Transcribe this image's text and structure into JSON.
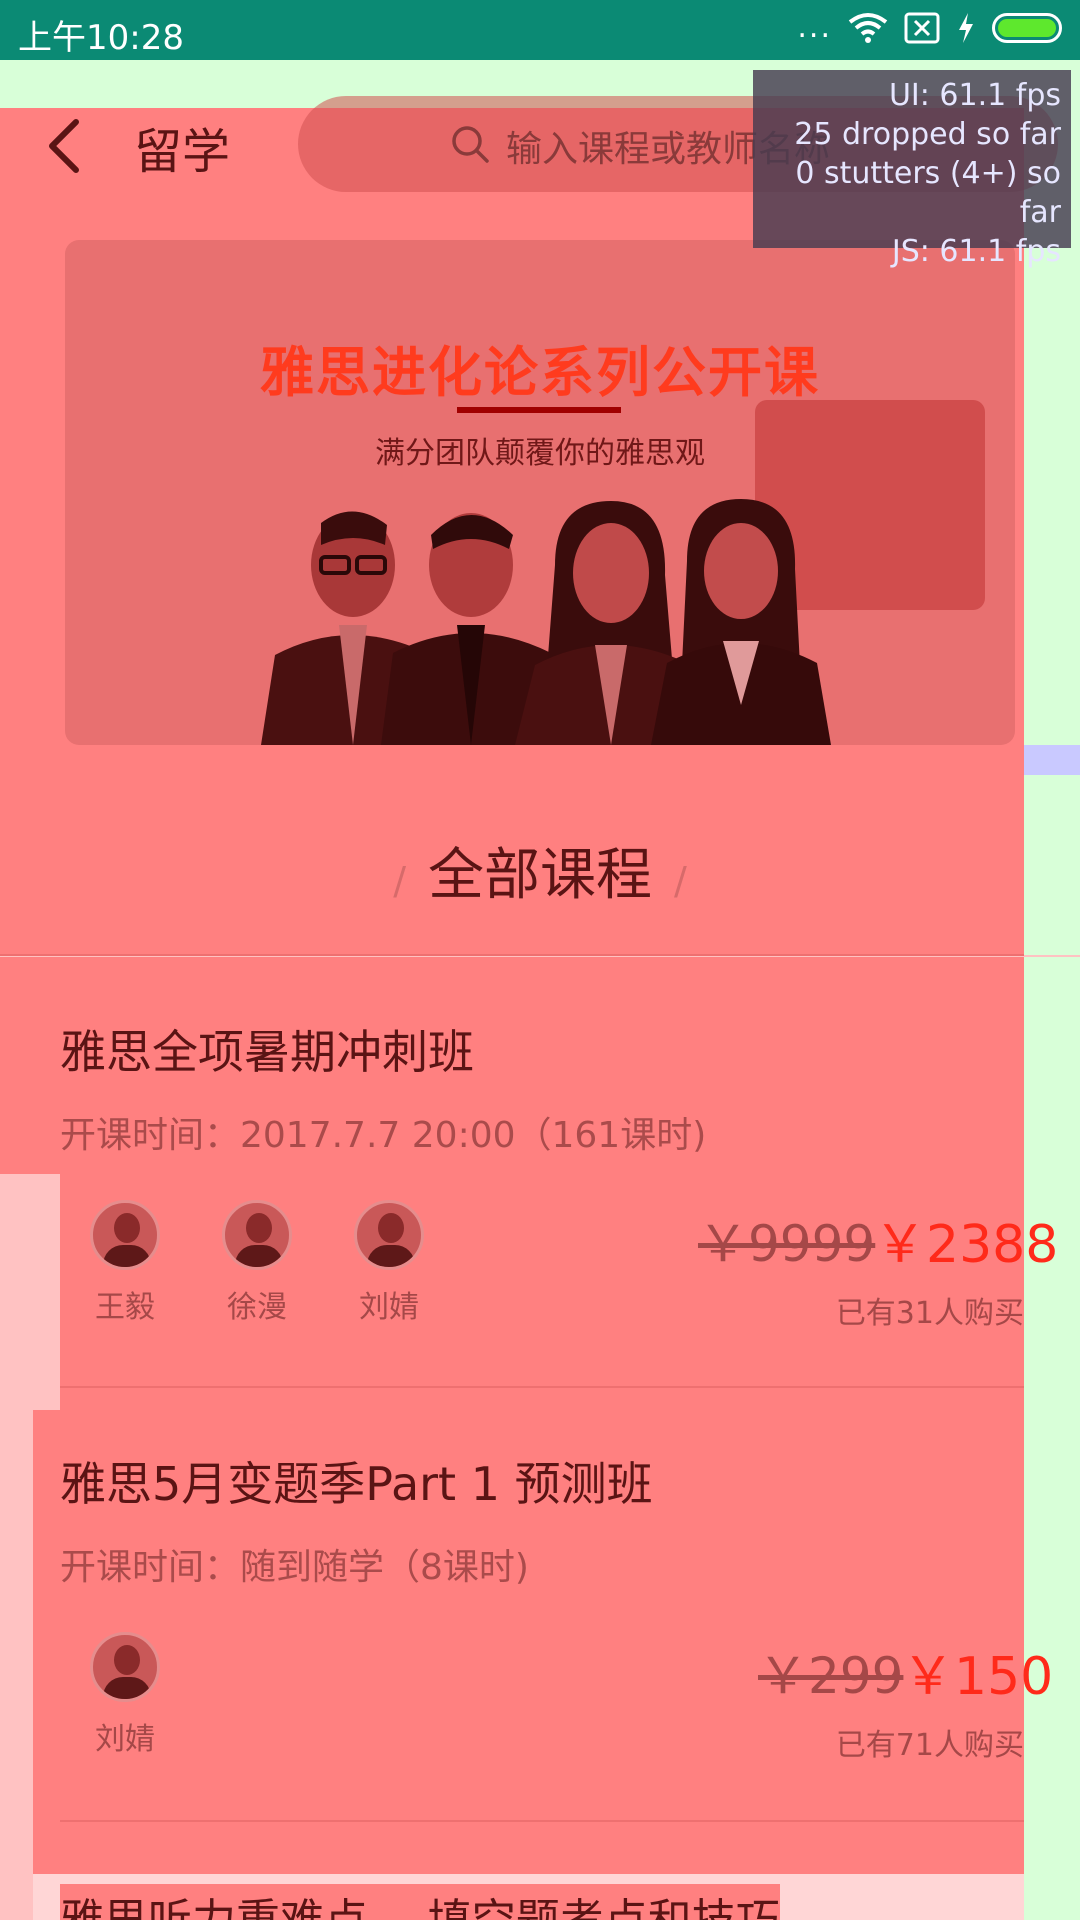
{
  "status_bar": {
    "time": "上午10:28",
    "dots": "...",
    "wifi_icon": "wifi-icon",
    "sim_icon": "no-sim-icon",
    "charging_icon": "charging-bolt-icon",
    "battery_level": 1.0
  },
  "header": {
    "title": "留学",
    "search_placeholder": "输入课程或教师名称"
  },
  "fps_overlay": {
    "ui": "UI: 61.1 fps",
    "dropped": "25 dropped so far",
    "stutters": "0 stutters (4+) so far",
    "js": "JS: 61.1 fps"
  },
  "banner": {
    "title": "雅思进化论系列公开课",
    "subtitle": "满分团队颠覆你的雅思观"
  },
  "section": {
    "title": "全部课程",
    "slash": "/"
  },
  "courses": [
    {
      "title": "雅思全项暑期冲刺班",
      "time": "开课时间：2017.7.7 20:00（161课时)",
      "teachers": [
        "王毅",
        "徐漫",
        "刘婧"
      ],
      "price_old": "￥9999",
      "price_new": "￥2388",
      "bought": "已有31人购买"
    },
    {
      "title": "雅思5月变题季Part 1 预测班",
      "time": "开课时间：随到随学（8课时)",
      "teachers": [
        "刘婧"
      ],
      "price_old": "￥299",
      "price_new": "￥150",
      "bought": "已有71人购买"
    },
    {
      "title": "雅思听力重难点 -- 填空题考点和技巧"
    }
  ],
  "colors": {
    "status_bar": "#0b8a74",
    "overdraw_red": "#ff8080",
    "overdraw_green": "#d8ffd8",
    "price_accent": "#ff2a1a"
  }
}
